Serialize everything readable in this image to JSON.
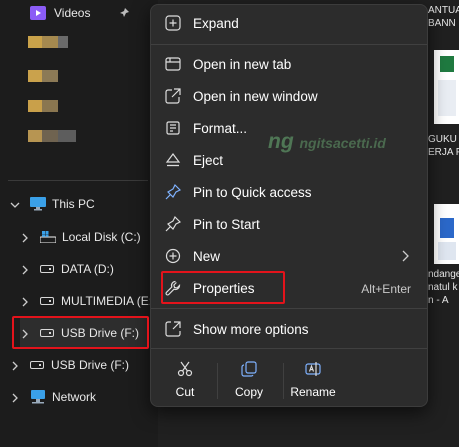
{
  "nav": {
    "videos": "Videos",
    "this_pc": "This PC",
    "local_disk": "Local Disk (C:)",
    "data": "DATA (D:)",
    "multimedia": "MULTIMEDIA (E:)",
    "usb_drive_1": "USB Drive (F:)",
    "usb_drive_2": "USB Drive (F:)",
    "network": "Network"
  },
  "content": {
    "text1a": "ANTUA",
    "text1b": "BANN",
    "text2a": "GUKU",
    "text2b": "ERJA P",
    "text3a": "ndange",
    "text3b": "natul k",
    "text3c": "n - A"
  },
  "watermark": {
    "logo": "ng",
    "site": "ngitsacetti.id"
  },
  "menu": {
    "expand": "Expand",
    "open_new_tab": "Open in new tab",
    "open_new_window": "Open in new window",
    "format": "Format...",
    "eject": "Eject",
    "pin_quick": "Pin to Quick access",
    "pin_start": "Pin to Start",
    "new": "New",
    "properties": "Properties",
    "properties_shortcut": "Alt+Enter",
    "more_options": "Show more options",
    "cut": "Cut",
    "copy": "Copy",
    "rename": "Rename"
  },
  "colors": {
    "highlight": "#e3131b",
    "menu_bg": "#2c2c2c",
    "nav_bg": "#1c1c1c"
  }
}
